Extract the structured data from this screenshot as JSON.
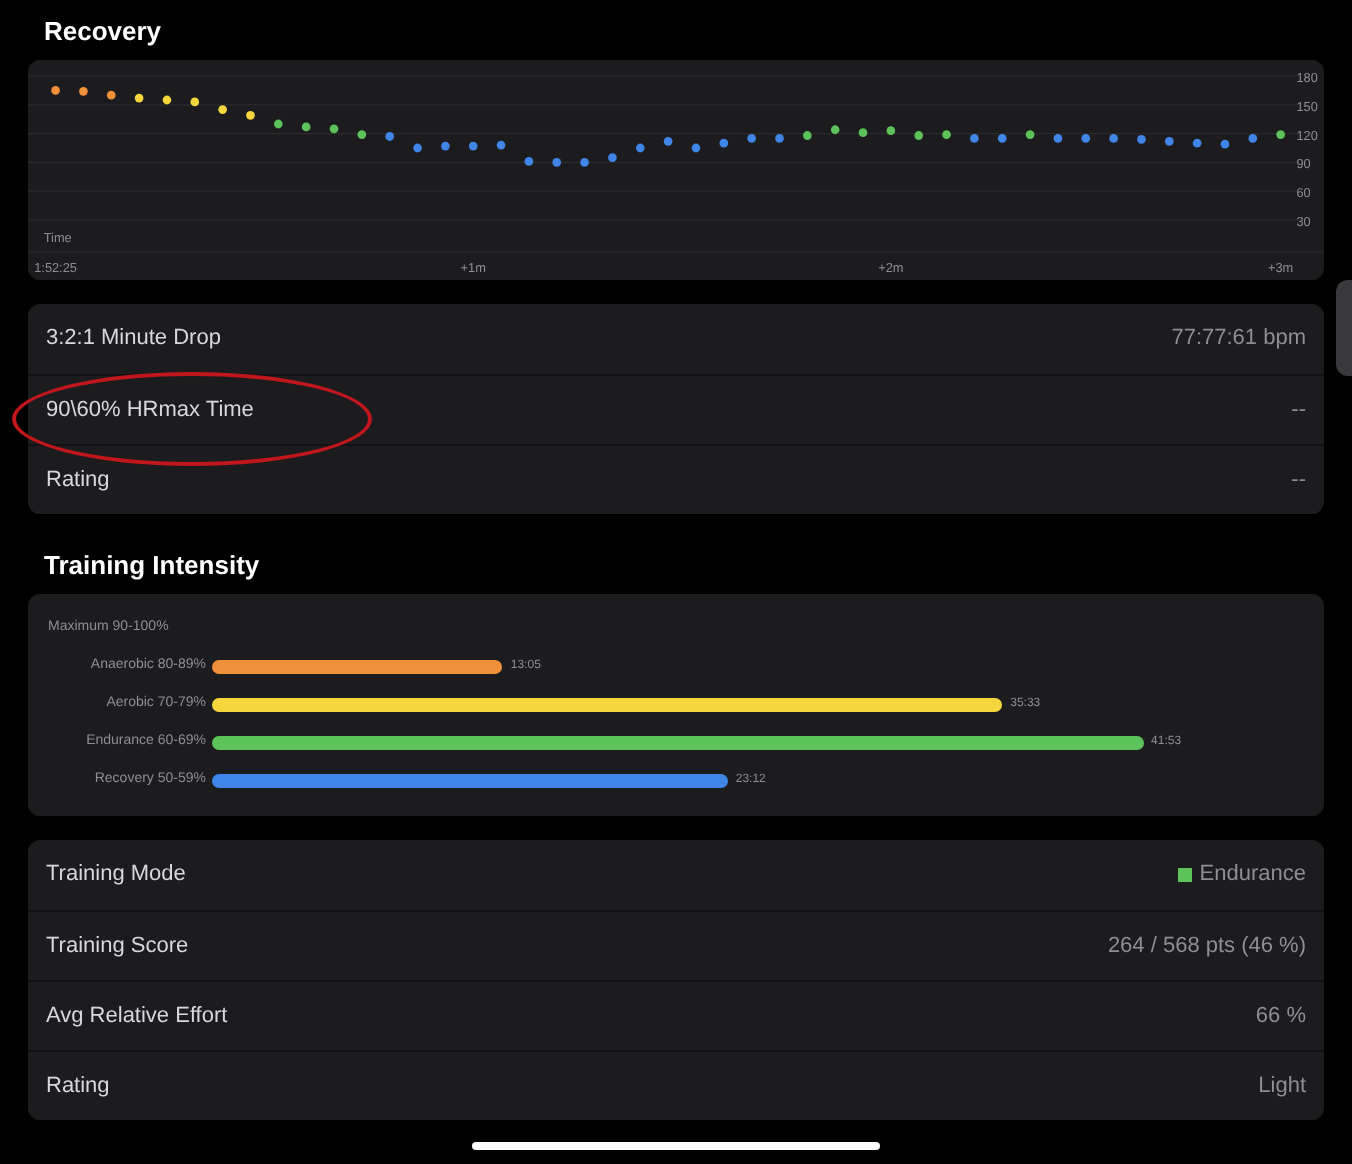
{
  "recovery": {
    "title": "Recovery",
    "chart_data": {
      "type": "scatter",
      "xlabel": "Time",
      "categories": [
        "1:52:25",
        null,
        null,
        null,
        null,
        null,
        null,
        null,
        null,
        null,
        null,
        null,
        null,
        null,
        null,
        "+1m",
        null,
        null,
        null,
        null,
        null,
        null,
        null,
        null,
        null,
        null,
        null,
        null,
        null,
        null,
        "+2m",
        null,
        null,
        null,
        null,
        null,
        null,
        null,
        null,
        null,
        null,
        null,
        null,
        null,
        "+3m"
      ],
      "series": [
        {
          "color": "#f0913a",
          "values": [
            165,
            164,
            160,
            null,
            null,
            null,
            null,
            null,
            null,
            null,
            null,
            null,
            null,
            null,
            null,
            null,
            null,
            null,
            null,
            null,
            null,
            null,
            null,
            null,
            null,
            null,
            null,
            null,
            null,
            null,
            null,
            null,
            null,
            null,
            null,
            null,
            null,
            null,
            null,
            null,
            null,
            null,
            null,
            null,
            null
          ]
        },
        {
          "color": "#f5d63d",
          "values": [
            null,
            null,
            null,
            157,
            155,
            153,
            145,
            139,
            null,
            null,
            null,
            null,
            null,
            null,
            null,
            null,
            null,
            null,
            null,
            null,
            null,
            null,
            null,
            null,
            null,
            null,
            null,
            null,
            null,
            null,
            null,
            null,
            null,
            null,
            null,
            null,
            null,
            null,
            null,
            null,
            null,
            null,
            null,
            null,
            null
          ]
        },
        {
          "color": "#5cc25a",
          "values": [
            null,
            null,
            null,
            null,
            null,
            null,
            null,
            null,
            130,
            127,
            125,
            119,
            null,
            null,
            null,
            null,
            null,
            null,
            null,
            null,
            null,
            null,
            null,
            null,
            null,
            null,
            null,
            118,
            124,
            121,
            123,
            118,
            119,
            null,
            null,
            119,
            null,
            null,
            null,
            null,
            null,
            null,
            null,
            null,
            119
          ]
        },
        {
          "color": "#3f86e8",
          "values": [
            null,
            null,
            null,
            null,
            null,
            null,
            null,
            null,
            null,
            null,
            null,
            null,
            117,
            105,
            107,
            107,
            108,
            91,
            90,
            90,
            95,
            105,
            112,
            105,
            110,
            115,
            115,
            null,
            null,
            null,
            null,
            null,
            null,
            115,
            115,
            null,
            115,
            115,
            115,
            114,
            112,
            110,
            109,
            115,
            null
          ]
        }
      ],
      "ylim": [
        30,
        180
      ],
      "grid": true,
      "yticks": [
        30,
        60,
        90,
        120,
        150,
        180
      ]
    },
    "rows": [
      {
        "label": "3:2:1 Minute Drop",
        "value": "77:77:61 bpm"
      },
      {
        "label": "90\\60% HRmax Time",
        "value": "--"
      },
      {
        "label": "Rating",
        "value": "--"
      }
    ]
  },
  "markup": {
    "kind": "ellipse",
    "color": "#c0161c"
  },
  "training_intensity": {
    "title": "Training Intensity",
    "zones": [
      {
        "label": "Maximum 90-100%"
      },
      {
        "label": "Anaerobic 80-89%",
        "color": "#f0913a",
        "reading": "13:05"
      },
      {
        "label": "Aerobic 70-79%",
        "color": "#f5d63d",
        "reading": "35:33"
      },
      {
        "label": "Endurance 60-69%",
        "color": "#5cc25a",
        "reading": "41:53"
      },
      {
        "label": "Recovery 50-59%",
        "color": "#3f86e8",
        "reading": "23:12"
      }
    ],
    "rows": [
      {
        "label": "Training Mode",
        "value": "Endurance",
        "color": "#5cc25a"
      },
      {
        "label": "Training Score",
        "value": "264 / 568 pts (46 %)"
      },
      {
        "label": "Avg Relative Effort",
        "value": "66 %"
      },
      {
        "label": "Rating",
        "value": "Light"
      }
    ]
  }
}
